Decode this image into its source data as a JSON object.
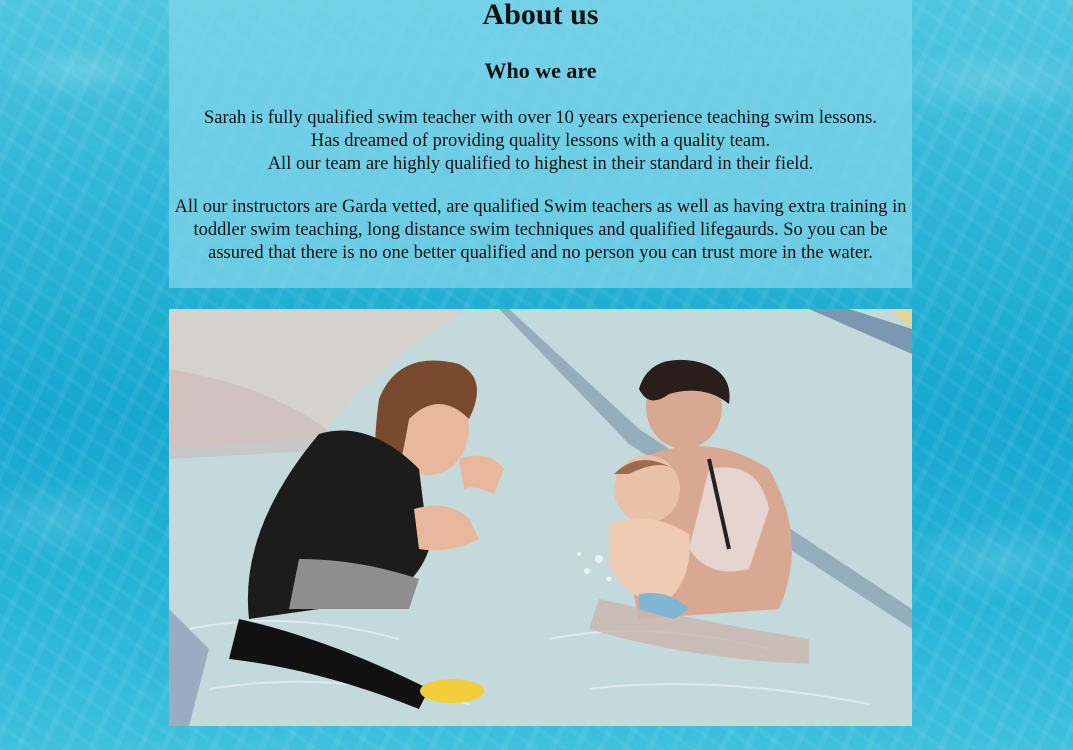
{
  "page": {
    "title": "About us",
    "subtitle": "Who we are",
    "paragraph_1": [
      "Sarah is fully qualified swim teacher with over 10 years experience teaching swim lessons.",
      "Has dreamed of providing quality lessons with a quality team.",
      "All our team are highly qualified to highest in their standard in their field."
    ],
    "paragraph_2": "All our instructors are Garda vetted, are qualified Swim teachers as well as having extra training in toddler swim teaching, long distance swim techniques and qualified lifegaurds. So you can be assured that there is no one better qualified and no person you can trust more in the water."
  },
  "colors": {
    "background": "#1aa9d0",
    "panel": "#7dd4e8",
    "text": "#111111"
  }
}
